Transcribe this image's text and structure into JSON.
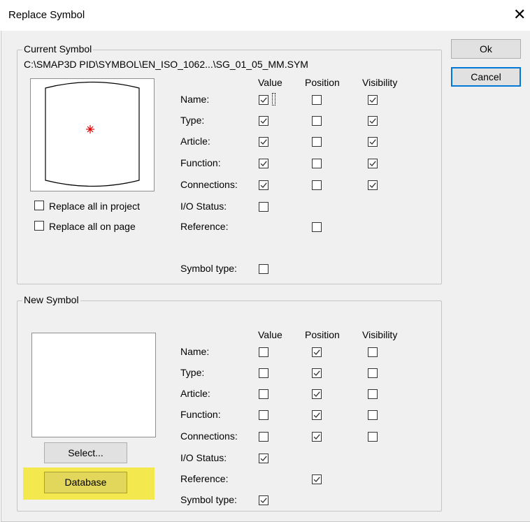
{
  "window": {
    "title": "Replace Symbol",
    "close_glyph": "✕"
  },
  "buttons": {
    "ok_label": "Ok",
    "cancel_label": "Cancel"
  },
  "current": {
    "group_label": "Current Symbol",
    "path": "C:\\SMAP3D PID\\SYMBOL\\EN_ISO_1062...\\SG_01_05_MM.SYM",
    "headers": {
      "value": "Value",
      "position": "Position",
      "visibility": "Visibility"
    },
    "rows": [
      {
        "label": "Name:",
        "value": true,
        "position": false,
        "visibility": true
      },
      {
        "label": "Type:",
        "value": true,
        "position": false,
        "visibility": true
      },
      {
        "label": "Article:",
        "value": true,
        "position": false,
        "visibility": true
      },
      {
        "label": "Function:",
        "value": true,
        "position": false,
        "visibility": true
      },
      {
        "label": "Connections:",
        "value": true,
        "position": false,
        "visibility": true
      },
      {
        "label": "I/O Status:",
        "value": false
      },
      {
        "label": "Reference:",
        "position": false
      },
      {
        "label": "Symbol type:",
        "value": false
      }
    ],
    "replace_all_project": {
      "label": "Replace all in project",
      "checked": false
    },
    "replace_all_page": {
      "label": "Replace all on page",
      "checked": false
    }
  },
  "new": {
    "group_label": "New Symbol",
    "headers": {
      "value": "Value",
      "position": "Position",
      "visibility": "Visibility"
    },
    "rows": [
      {
        "label": "Name:",
        "value": false,
        "position": true,
        "visibility": false
      },
      {
        "label": "Type:",
        "value": false,
        "position": true,
        "visibility": false
      },
      {
        "label": "Article:",
        "value": false,
        "position": true,
        "visibility": false
      },
      {
        "label": "Function:",
        "value": false,
        "position": true,
        "visibility": false
      },
      {
        "label": "Connections:",
        "value": false,
        "position": true,
        "visibility": false
      },
      {
        "label": "I/O Status:",
        "value": true
      },
      {
        "label": "Reference:",
        "position": true
      },
      {
        "label": "Symbol type:",
        "value": true
      }
    ],
    "select_label": "Select...",
    "database_label": "Database"
  },
  "colors": {
    "highlight": "#f3e94f",
    "symbol_marker": "#e00000",
    "default_button_border": "#0078d7"
  },
  "icons": {
    "close": "close-icon",
    "checkmark": "checkmark-icon",
    "symbol_marker": "asterisk-icon"
  }
}
